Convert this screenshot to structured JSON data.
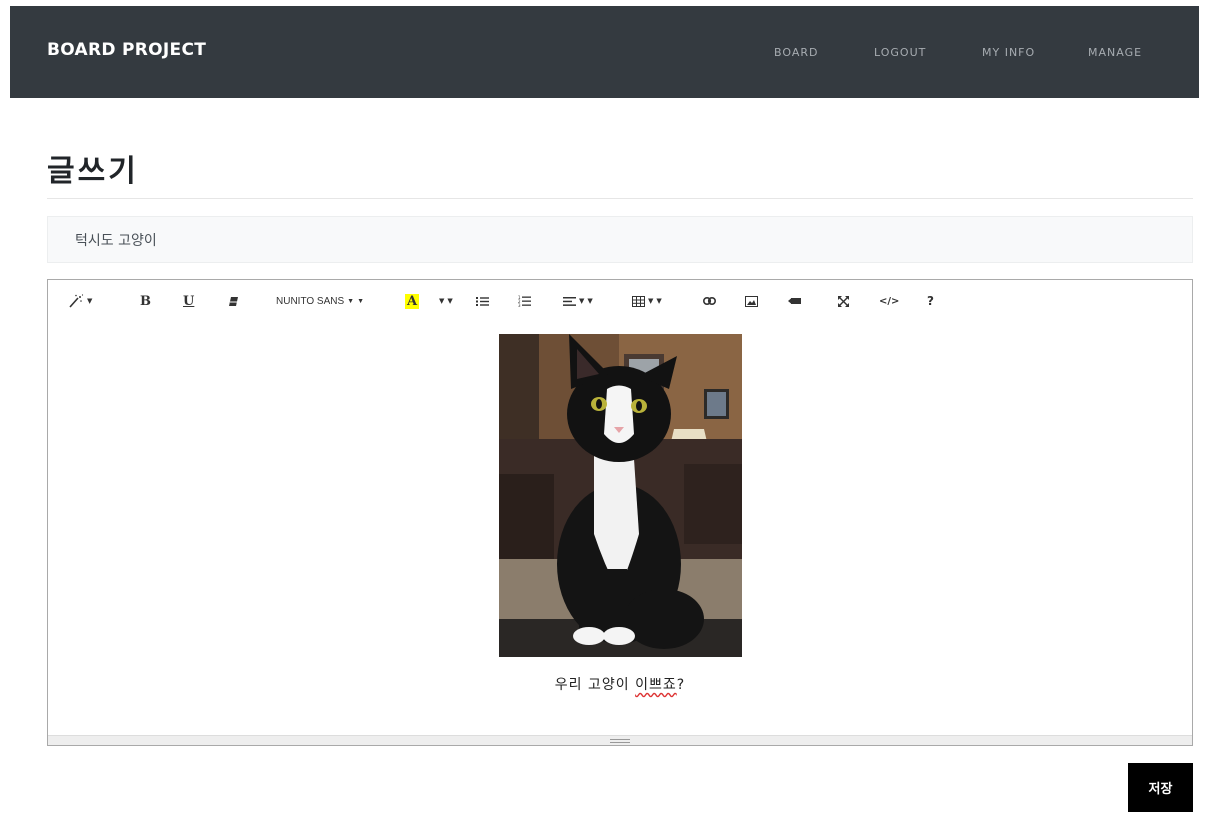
{
  "navbar": {
    "brand": "BOARD PROJECT",
    "links": [
      {
        "label": "BOARD"
      },
      {
        "label": "LOGOUT"
      },
      {
        "label": "MY INFO"
      },
      {
        "label": "MANAGE"
      }
    ],
    "bg_color": "#343a40"
  },
  "page": {
    "title": "글쓰기"
  },
  "form": {
    "title_value": "턱시도 고양이",
    "save_label": "저장"
  },
  "editor": {
    "toolbar": {
      "magic_icon": "magic-wand-icon",
      "bold_label": "B",
      "underline_label": "U",
      "eraser_icon": "eraser-icon",
      "font_name": "NUNITO SANS",
      "color_label": "A",
      "highlight_color": "#ffff00",
      "ul_icon": "unordered-list-icon",
      "ol_icon": "ordered-list-icon",
      "align_icon": "align-icon",
      "table_icon": "table-icon",
      "link_icon": "link-icon",
      "picture_icon": "picture-icon",
      "video_icon": "video-icon",
      "fullscreen_icon": "fullscreen-icon",
      "codeview_label": "</>",
      "help_label": "?"
    },
    "image_icon": "tuxedo-cat-photo",
    "caption_prefix": "우리 고양이 ",
    "caption_misspelled": "이쁘죠",
    "caption_suffix": "?"
  }
}
